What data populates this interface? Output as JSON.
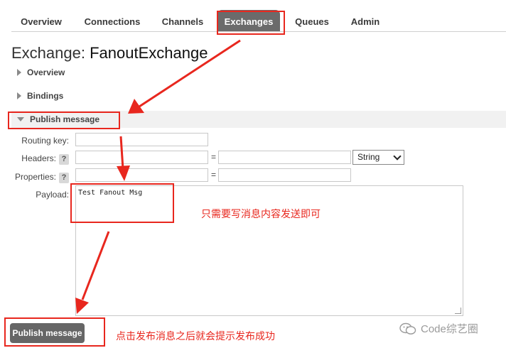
{
  "nav": {
    "tabs": [
      {
        "label": "Overview"
      },
      {
        "label": "Connections"
      },
      {
        "label": "Channels"
      },
      {
        "label": "Exchanges",
        "active": true
      },
      {
        "label": "Queues"
      },
      {
        "label": "Admin"
      }
    ]
  },
  "title": {
    "prefix": "Exchange:",
    "name": "FanoutExchange"
  },
  "sections": {
    "overview": "Overview",
    "bindings": "Bindings",
    "publish": "Publish message"
  },
  "form": {
    "routing_key_label": "Routing key:",
    "headers_label": "Headers:",
    "properties_label": "Properties:",
    "payload_label": "Payload:",
    "help_symbol": "?",
    "equals": "=",
    "header_type_selected": "String",
    "payload_value": "Test Fanout Msg",
    "submit_label": "Publish message"
  },
  "annotations": {
    "payload_note": "只需要写消息内容发送即可",
    "publish_note": "点击发布消息之后就会提示发布成功",
    "color": "#e8271e"
  },
  "watermark": "Code综艺圈"
}
